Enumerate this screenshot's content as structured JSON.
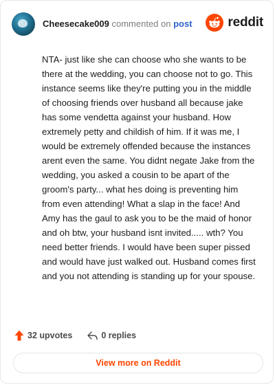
{
  "header": {
    "username": "Cheesecake009",
    "commented_text": "commented on",
    "post_link_label": "post",
    "brand": "reddit"
  },
  "comment": {
    "body": "NTA- just like she can choose who she wants to be there at the wedding, you can choose not to go. This instance seems like they're putting you in the middle of choosing friends over husband all because jake has some vendetta against your husband. How extremely petty and childish of him. If it was me, I would be extremely offended because the instances arent even the same. You didnt negate Jake from the wedding, you asked a cousin to be apart of the groom's party... what hes doing is preventing him from even attending! What a slap in the face! And Amy has the gaul to ask you to be the maid of honor and oh btw, your husband isnt invited..... wth? You need better friends. I would have been super pissed and would have just walked out. Husband comes first and you not attending is standing up for your spouse."
  },
  "actions": {
    "upvotes_label": "32 upvotes",
    "replies_label": "0 replies"
  },
  "footer": {
    "view_more_label": "View more on Reddit"
  },
  "colors": {
    "brand_orange": "#ff4500",
    "link_blue": "#2d63c8",
    "muted_text": "#7c7c7c"
  },
  "icons": {
    "avatar": "avatar-image",
    "logo": "reddit-alien-icon",
    "upvote": "upvote-arrow-icon",
    "reply": "reply-arrow-icon"
  }
}
